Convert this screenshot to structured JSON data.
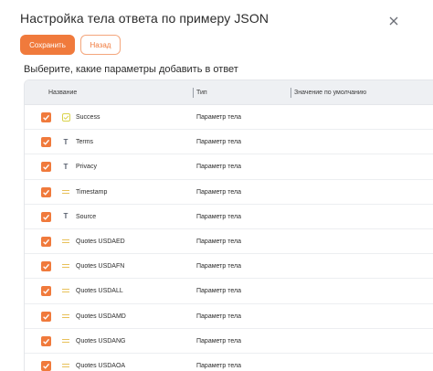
{
  "dialog": {
    "title": "Настройка тела ответа по примеру JSON",
    "save_label": "Сохранить",
    "back_label": "Назад",
    "subtitle": "Выберите, какие параметры добавить в ответ",
    "close_icon": "close-icon"
  },
  "colors": {
    "accent": "#f07a3c",
    "header_bg": "#eef0f3",
    "bool_icon": "#d9d24a",
    "number_icon": "#e8c15a"
  },
  "table": {
    "columns": [
      "Название",
      "Тип",
      "Значение по умолчанию"
    ],
    "rows": [
      {
        "name": "Success",
        "icon": "boolean-icon",
        "type": "Параметр тела",
        "checked": true
      },
      {
        "name": "Terms",
        "icon": "text-icon",
        "type": "Параметр тела",
        "checked": true
      },
      {
        "name": "Privacy",
        "icon": "text-icon",
        "type": "Параметр тела",
        "checked": true
      },
      {
        "name": "Timestamp",
        "icon": "number-icon",
        "type": "Параметр тела",
        "checked": true
      },
      {
        "name": "Source",
        "icon": "text-icon",
        "type": "Параметр тела",
        "checked": true
      },
      {
        "name": "Quotes USDAED",
        "icon": "number-icon",
        "type": "Параметр тела",
        "checked": true
      },
      {
        "name": "Quotes USDAFN",
        "icon": "number-icon",
        "type": "Параметр тела",
        "checked": true
      },
      {
        "name": "Quotes USDALL",
        "icon": "number-icon",
        "type": "Параметр тела",
        "checked": true
      },
      {
        "name": "Quotes USDAMD",
        "icon": "number-icon",
        "type": "Параметр тела",
        "checked": true
      },
      {
        "name": "Quotes USDANG",
        "icon": "number-icon",
        "type": "Параметр тела",
        "checked": true
      },
      {
        "name": "Quotes USDAOA",
        "icon": "number-icon",
        "type": "Параметр тела",
        "checked": true
      }
    ]
  }
}
